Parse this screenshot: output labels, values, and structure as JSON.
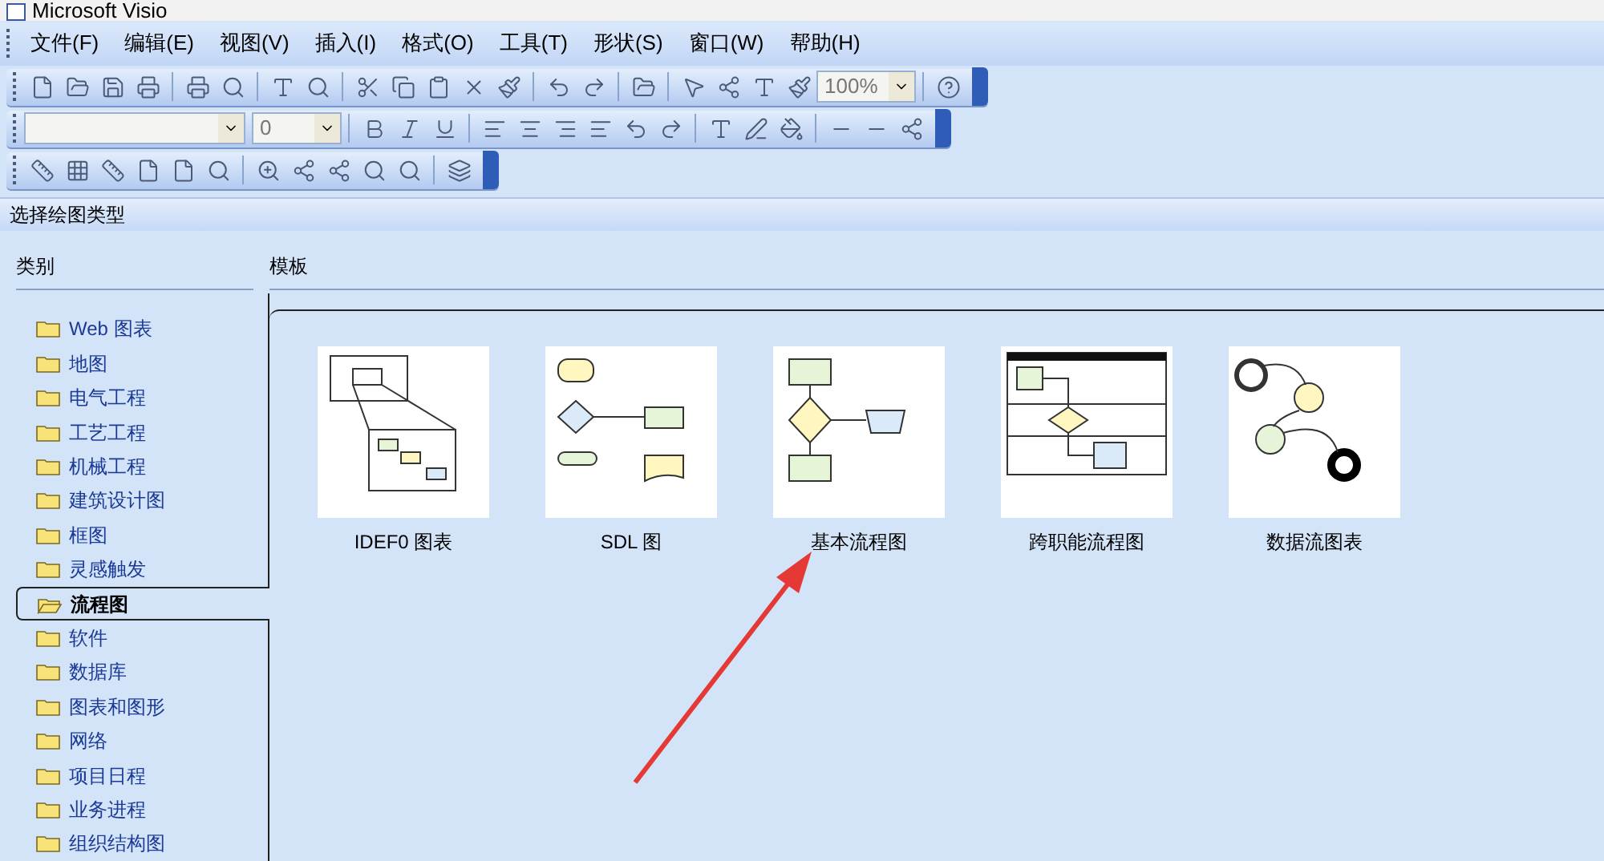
{
  "window": {
    "title": "Microsoft Visio"
  },
  "menu": [
    "文件(F)",
    "编辑(E)",
    "视图(V)",
    "插入(I)",
    "格式(O)",
    "工具(T)",
    "形状(S)",
    "窗口(W)",
    "帮助(H)"
  ],
  "toolbars": {
    "zoom": "100%",
    "font_size": "0"
  },
  "dialog": {
    "title": "选择绘图类型",
    "category_heading": "类别",
    "template_heading": "模板"
  },
  "categories": [
    {
      "label": "Web 图表",
      "selected": false
    },
    {
      "label": "地图",
      "selected": false
    },
    {
      "label": "电气工程",
      "selected": false
    },
    {
      "label": "工艺工程",
      "selected": false
    },
    {
      "label": "机械工程",
      "selected": false
    },
    {
      "label": "建筑设计图",
      "selected": false
    },
    {
      "label": "框图",
      "selected": false
    },
    {
      "label": "灵感触发",
      "selected": false
    },
    {
      "label": "流程图",
      "selected": true
    },
    {
      "label": "软件",
      "selected": false
    },
    {
      "label": "数据库",
      "selected": false
    },
    {
      "label": "图表和图形",
      "selected": false
    },
    {
      "label": "网络",
      "selected": false
    },
    {
      "label": "项目日程",
      "selected": false
    },
    {
      "label": "业务进程",
      "selected": false
    },
    {
      "label": "组织结构图",
      "selected": false
    }
  ],
  "templates": [
    {
      "label": "IDEF0 图表",
      "kind": "idef0"
    },
    {
      "label": "SDL 图",
      "kind": "sdl"
    },
    {
      "label": "基本流程图",
      "kind": "flowchart"
    },
    {
      "label": "跨职能流程图",
      "kind": "swimlane"
    },
    {
      "label": "数据流图表",
      "kind": "dataflow"
    }
  ]
}
